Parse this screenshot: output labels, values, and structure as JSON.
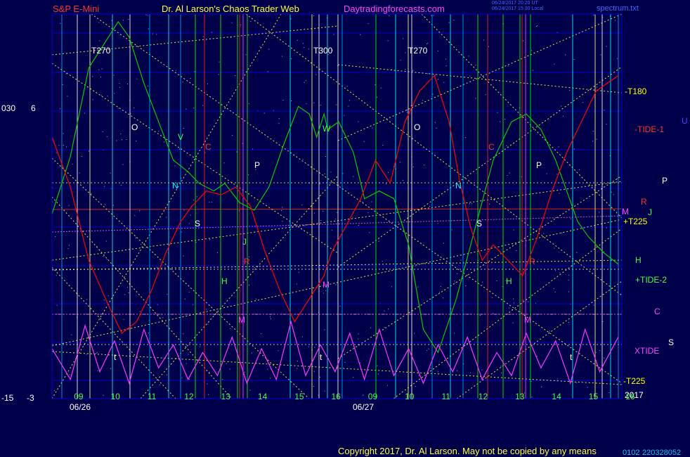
{
  "header": {
    "instrument": "S&P E-Mini",
    "site_title": "Dr. Al Larson's Chaos Trader Web",
    "site_url": "Daytradingforecasts.com",
    "stamp_1": "06/24/2017 20:20 UT",
    "stamp_2": "06/24/2017 15:30 Local",
    "file_name": "spectrum.txt"
  },
  "footer": {
    "copyright": "Copyright 2017, Dr. Al Larson. May not be copied by any means",
    "code": "0102",
    "id": "220328052"
  },
  "left_axis": {
    "top_a": "030",
    "top_b": "6",
    "bottom_a": "-15",
    "bottom_b": "-3"
  },
  "colors": {
    "background": "#00004a",
    "grid": "#0000c8",
    "price": "#00cc00",
    "tide1": "#ff0000",
    "xtide": "#ff33ff",
    "timing": "#ffff00"
  },
  "chart_data": {
    "type": "line",
    "x_unit": "hour of day",
    "dates": [
      "06/26",
      "06/27"
    ],
    "hour_labels": [
      "09",
      "10",
      "11",
      "12",
      "13",
      "14",
      "15",
      "16",
      "09",
      "10",
      "11",
      "12",
      "13",
      "14",
      "15",
      "16"
    ],
    "year": "2017",
    "right_labels": [
      {
        "text": "-T180",
        "color": "#ffff00"
      },
      {
        "text": "-TIDE-1",
        "color": "#ff3030"
      },
      {
        "text": "P",
        "color": "#ffffff"
      },
      {
        "text": "R",
        "color": "#ff3030"
      },
      {
        "text": "M",
        "color": "#ff44ff"
      },
      {
        "text": "J",
        "color": "#44ff44"
      },
      {
        "text": "+T225",
        "color": "#ffff00"
      },
      {
        "text": "H",
        "color": "#44ff44"
      },
      {
        "text": "+TIDE-2",
        "color": "#44ff44"
      },
      {
        "text": "C",
        "color": "#ff44ff"
      },
      {
        "text": "XTIDE",
        "color": "#ff44ff"
      },
      {
        "text": "S",
        "color": "#ffffff"
      },
      {
        "text": "-T225",
        "color": "#ffff00"
      },
      {
        "text": "U",
        "color": "#4444ff"
      }
    ],
    "chart_labels": [
      {
        "text": "T270",
        "color": "#ffffff"
      },
      {
        "text": "T300",
        "color": "#ffffff"
      },
      {
        "text": "T270",
        "color": "#ffffff"
      },
      {
        "text": "O",
        "color": "#ffffff"
      },
      {
        "text": "V",
        "color": "#44ff44"
      },
      {
        "text": "C",
        "color": "#ff3030"
      },
      {
        "text": "N",
        "color": "#00ffff"
      },
      {
        "text": "P",
        "color": "#ffffff"
      },
      {
        "text": "W",
        "color": "#44ff44"
      },
      {
        "text": "S",
        "color": "#ffffff"
      },
      {
        "text": "J",
        "color": "#44ff44"
      },
      {
        "text": "R",
        "color": "#ff3030"
      },
      {
        "text": "H",
        "color": "#44ff44"
      },
      {
        "text": "M",
        "color": "#ff44ff"
      },
      {
        "text": "M",
        "color": "#ff44ff"
      },
      {
        "text": "O",
        "color": "#ffffff"
      },
      {
        "text": "C",
        "color": "#ff3030"
      },
      {
        "text": "N",
        "color": "#00ffff"
      },
      {
        "text": "P",
        "color": "#ffffff"
      },
      {
        "text": "S",
        "color": "#ffffff"
      },
      {
        "text": "R",
        "color": "#ff3030"
      },
      {
        "text": "H",
        "color": "#44ff44"
      },
      {
        "text": "M",
        "color": "#ff44ff"
      },
      {
        "text": "t",
        "color": "#ffffff"
      },
      {
        "text": "t",
        "color": "#ffffff"
      },
      {
        "text": "t",
        "color": "#ffffff"
      }
    ],
    "series": [
      {
        "name": "S&P E-Mini",
        "color": "#00cc00",
        "x": [
          8.5,
          9.0,
          9.5,
          9.9,
          10.3,
          10.6,
          11.0,
          11.4,
          11.8,
          12.2,
          12.5,
          12.9,
          13.2,
          13.6,
          14.0,
          14.4,
          14.8,
          15.2,
          15.5,
          15.7,
          15.9,
          16.0,
          16.3,
          16.7,
          17.0,
          17.4,
          17.8,
          18.2,
          18.6,
          19.0,
          19.5,
          20.0,
          20.5,
          21.0,
          21.4,
          21.8,
          22.2,
          22.5,
          22.8,
          23.1,
          23.5,
          23.9
        ],
        "y": [
          48,
          63,
          86,
          92,
          98,
          94,
          82,
          72,
          62,
          59,
          56,
          54,
          56,
          51,
          49,
          55,
          66,
          76,
          74,
          68,
          74,
          70,
          72,
          64,
          52,
          54,
          52,
          40,
          18,
          12,
          26,
          44,
          62,
          72,
          74,
          70,
          62,
          54,
          46,
          42,
          38,
          35
        ]
      },
      {
        "name": "TIDE-1",
        "color": "#ff0000",
        "x": [
          8.5,
          9.0,
          9.5,
          10.0,
          10.4,
          10.8,
          11.2,
          11.6,
          12.0,
          12.3,
          12.7,
          13.1,
          13.5,
          13.9,
          14.3,
          14.7,
          15.1,
          15.5,
          15.9,
          16.1,
          16.5,
          16.9,
          17.3,
          17.7,
          18.1,
          18.5,
          18.9,
          19.3,
          19.6,
          19.9,
          20.2,
          20.5,
          20.9,
          21.3,
          21.7,
          22.1,
          22.5,
          22.9,
          23.3,
          23.9
        ],
        "y": [
          68,
          55,
          36,
          25,
          17,
          20,
          28,
          38,
          46,
          50,
          54,
          53,
          55,
          50,
          38,
          28,
          20,
          26,
          32,
          38,
          45,
          52,
          62,
          56,
          72,
          80,
          84,
          72,
          56,
          44,
          36,
          40,
          36,
          32,
          42,
          54,
          64,
          72,
          80,
          84
        ]
      },
      {
        "name": "XTIDE",
        "color": "#ff33ff",
        "x": [
          8.5,
          9.0,
          9.4,
          9.8,
          10.2,
          10.6,
          11.0,
          11.4,
          11.8,
          12.2,
          12.6,
          13.0,
          13.4,
          13.8,
          14.2,
          14.6,
          15.0,
          15.4,
          15.8,
          16.2,
          16.6,
          17.0,
          17.4,
          17.8,
          18.2,
          18.6,
          19.0,
          19.4,
          19.8,
          20.2,
          20.6,
          21.0,
          21.4,
          21.8,
          22.2,
          22.6,
          23.0,
          23.4,
          23.9
        ],
        "y": [
          13,
          5,
          19,
          7,
          15,
          4,
          18,
          8,
          14,
          5,
          12,
          6,
          16,
          4,
          13,
          5,
          20,
          6,
          14,
          7,
          17,
          5,
          18,
          6,
          13,
          4,
          14,
          7,
          16,
          5,
          12,
          6,
          17,
          8,
          15,
          4,
          18,
          7,
          16
        ]
      }
    ]
  }
}
